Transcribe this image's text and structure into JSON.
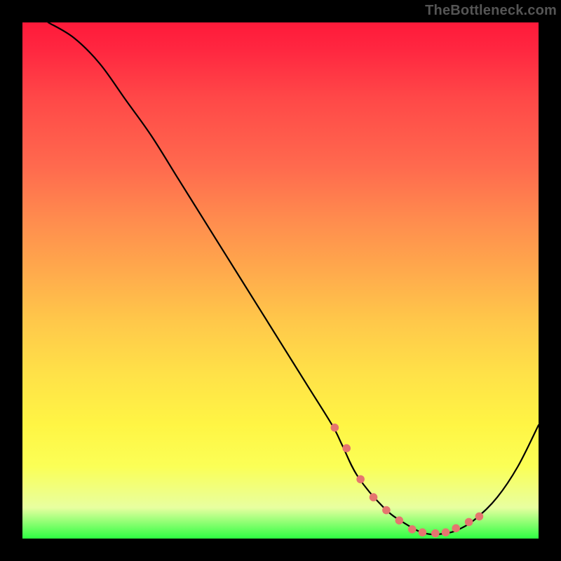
{
  "watermark": "TheBottleneck.com",
  "chart_data": {
    "type": "line",
    "title": "",
    "xlabel": "",
    "ylabel": "",
    "xlim": [
      0,
      100
    ],
    "ylim": [
      0,
      100
    ],
    "series": [
      {
        "name": "curve",
        "x": [
          5,
          10,
          15,
          20,
          25,
          30,
          35,
          40,
          45,
          50,
          55,
          60,
          62,
          65,
          70,
          74,
          78,
          82,
          85,
          88,
          92,
          96,
          100
        ],
        "values": [
          100,
          97,
          92,
          85,
          78,
          70,
          62,
          54,
          46,
          38,
          30,
          22,
          18,
          12,
          6,
          3,
          1,
          1,
          2,
          4,
          8,
          14,
          22
        ]
      }
    ],
    "markers": {
      "name": "highlight-dots",
      "color": "#e5756f",
      "x": [
        60.5,
        62.8,
        65.5,
        68.0,
        70.5,
        73.0,
        75.5,
        77.5,
        80.0,
        82.0,
        84.0,
        86.5,
        88.5
      ],
      "values": [
        21.5,
        17.5,
        11.5,
        8.0,
        5.5,
        3.5,
        1.8,
        1.2,
        1.0,
        1.2,
        2.0,
        3.2,
        4.3
      ]
    }
  }
}
